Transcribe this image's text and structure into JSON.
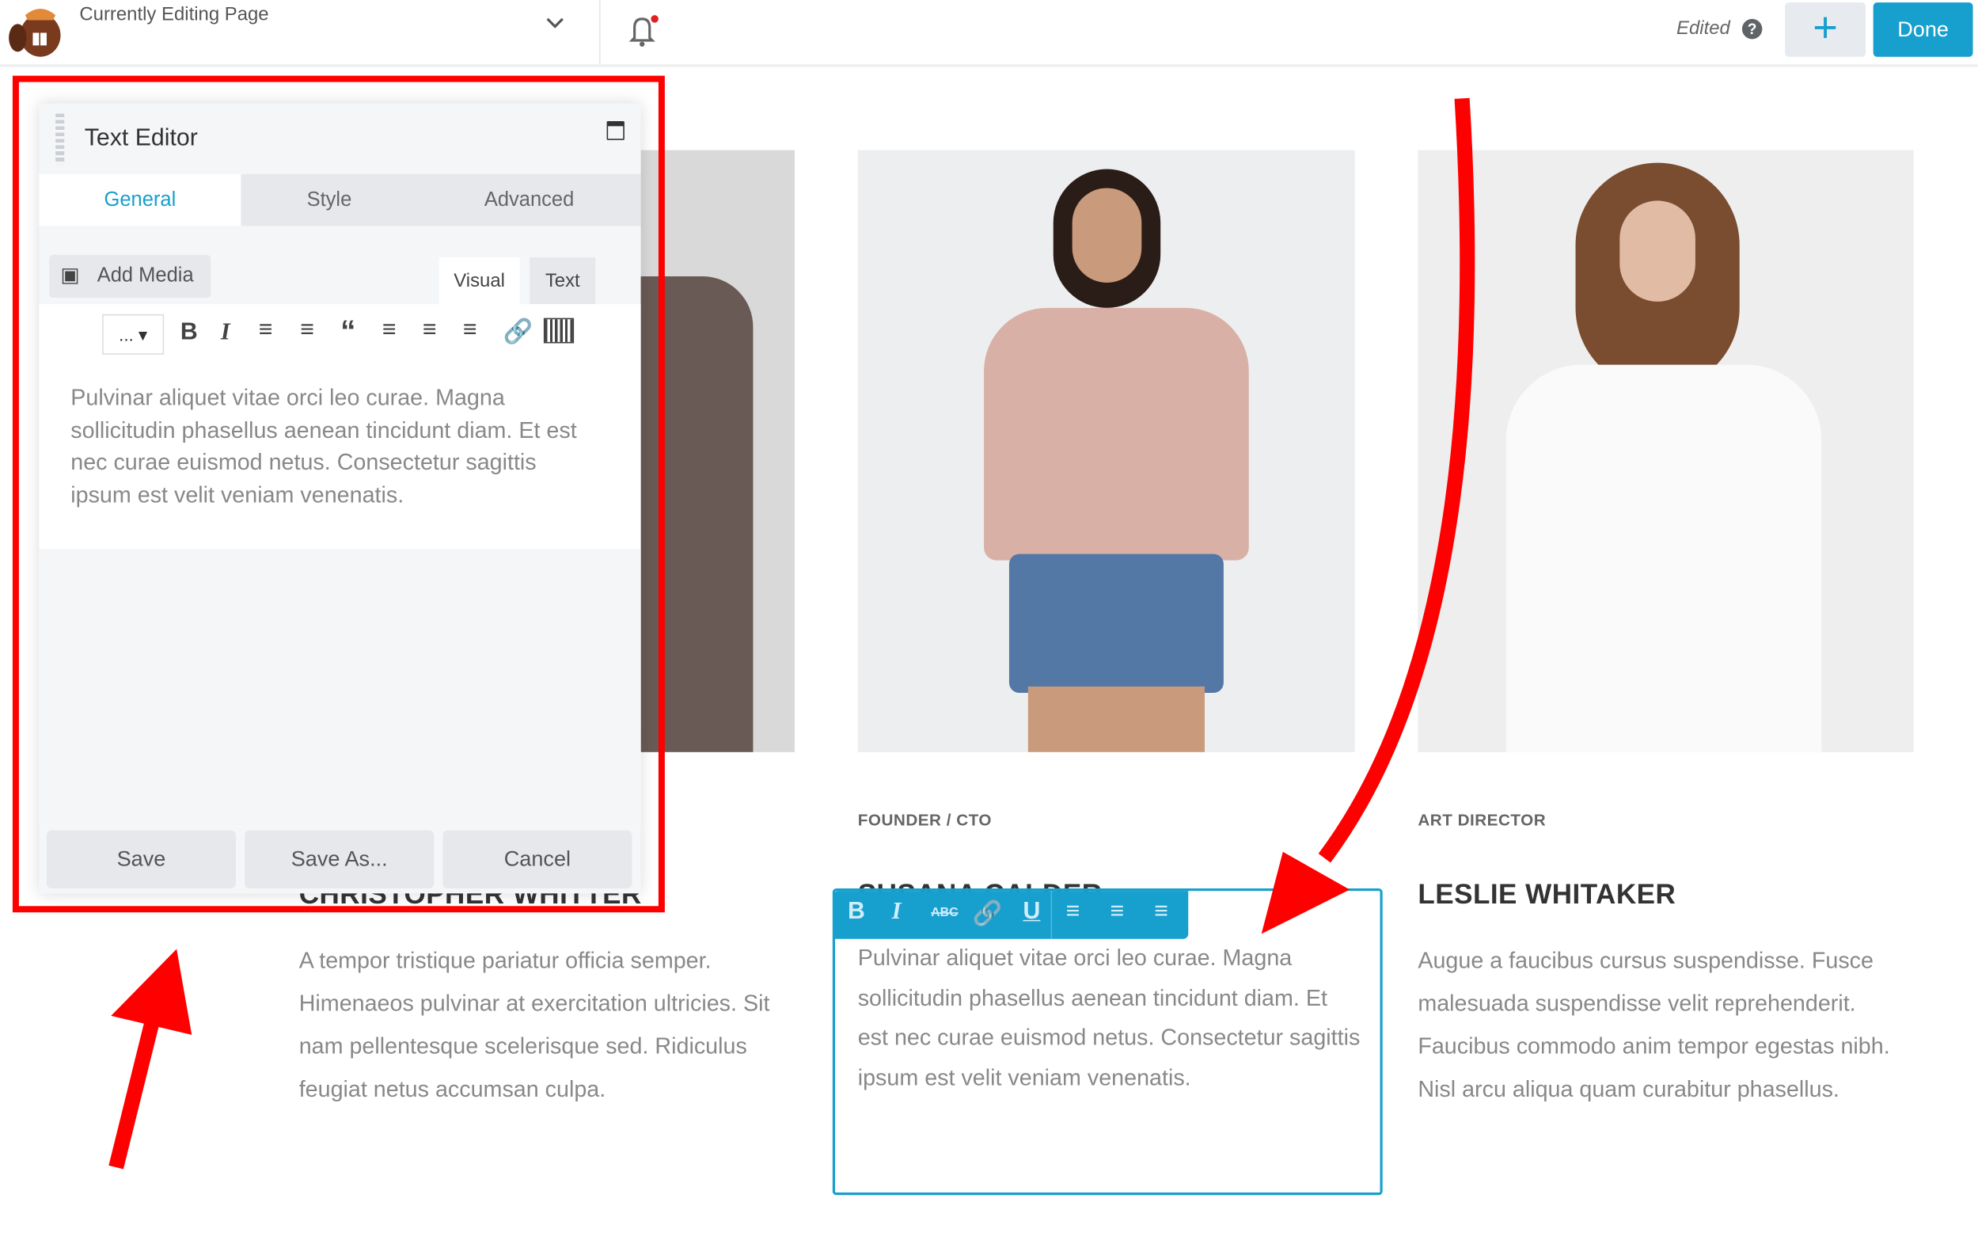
{
  "topbar": {
    "title": "Currently Editing Page",
    "status": "Edited",
    "done_label": "Done",
    "add_label": "+",
    "help_icon": "question-circle-icon",
    "accent": "#179fce"
  },
  "editor_panel": {
    "title": "Text Editor",
    "tabs": [
      {
        "label": "General",
        "active": true
      },
      {
        "label": "Style"
      },
      {
        "label": "Advanced"
      }
    ],
    "add_media": "Add Media",
    "mode_tabs": [
      {
        "label": "Visual",
        "active": true
      },
      {
        "label": "Text"
      }
    ],
    "format_select": "...",
    "content": "Pulvinar aliquet vitae orci leo curae. Magna sollicitudin phasellus aenean tincidunt diam. Et est nec curae euismod netus. Consectetur sagittis ipsum est velit veniam venenatis.",
    "buttons": {
      "save": "Save",
      "save_as": "Save As...",
      "cancel": "Cancel"
    }
  },
  "team": [
    {
      "role": "",
      "name": "CHRISTOPHER WHITTER",
      "bio": "A tempor tristique pariatur officia semper. Himenaeos pulvinar at exercitation ultricies. Sit nam pellentesque scelerisque sed. Ridiculus feugiat netus accumsan culpa."
    },
    {
      "role": "FOUNDER / CTO",
      "name": "SUSANA CALDER",
      "bio": "Pulvinar aliquet vitae orci leo curae. Magna sollicitudin phasellus aenean tincidunt diam. Et est nec curae euismod netus. Consectetur sagittis ipsum est velit veniam venenatis."
    },
    {
      "role": "ART DIRECTOR",
      "name": "LESLIE WHITAKER",
      "bio": "Augue a faucibus cursus suspendisse. Fusce malesuada suspendisse velit reprehenderit. Faucibus commodo anim tempor egestas nibh. Nisl arcu aliqua quam curabitur phasellus."
    }
  ],
  "inline_toolbar": {
    "bold": "B",
    "italic": "I",
    "strike": "ABC",
    "underline": "U"
  },
  "annotation_color": "#ff0000"
}
